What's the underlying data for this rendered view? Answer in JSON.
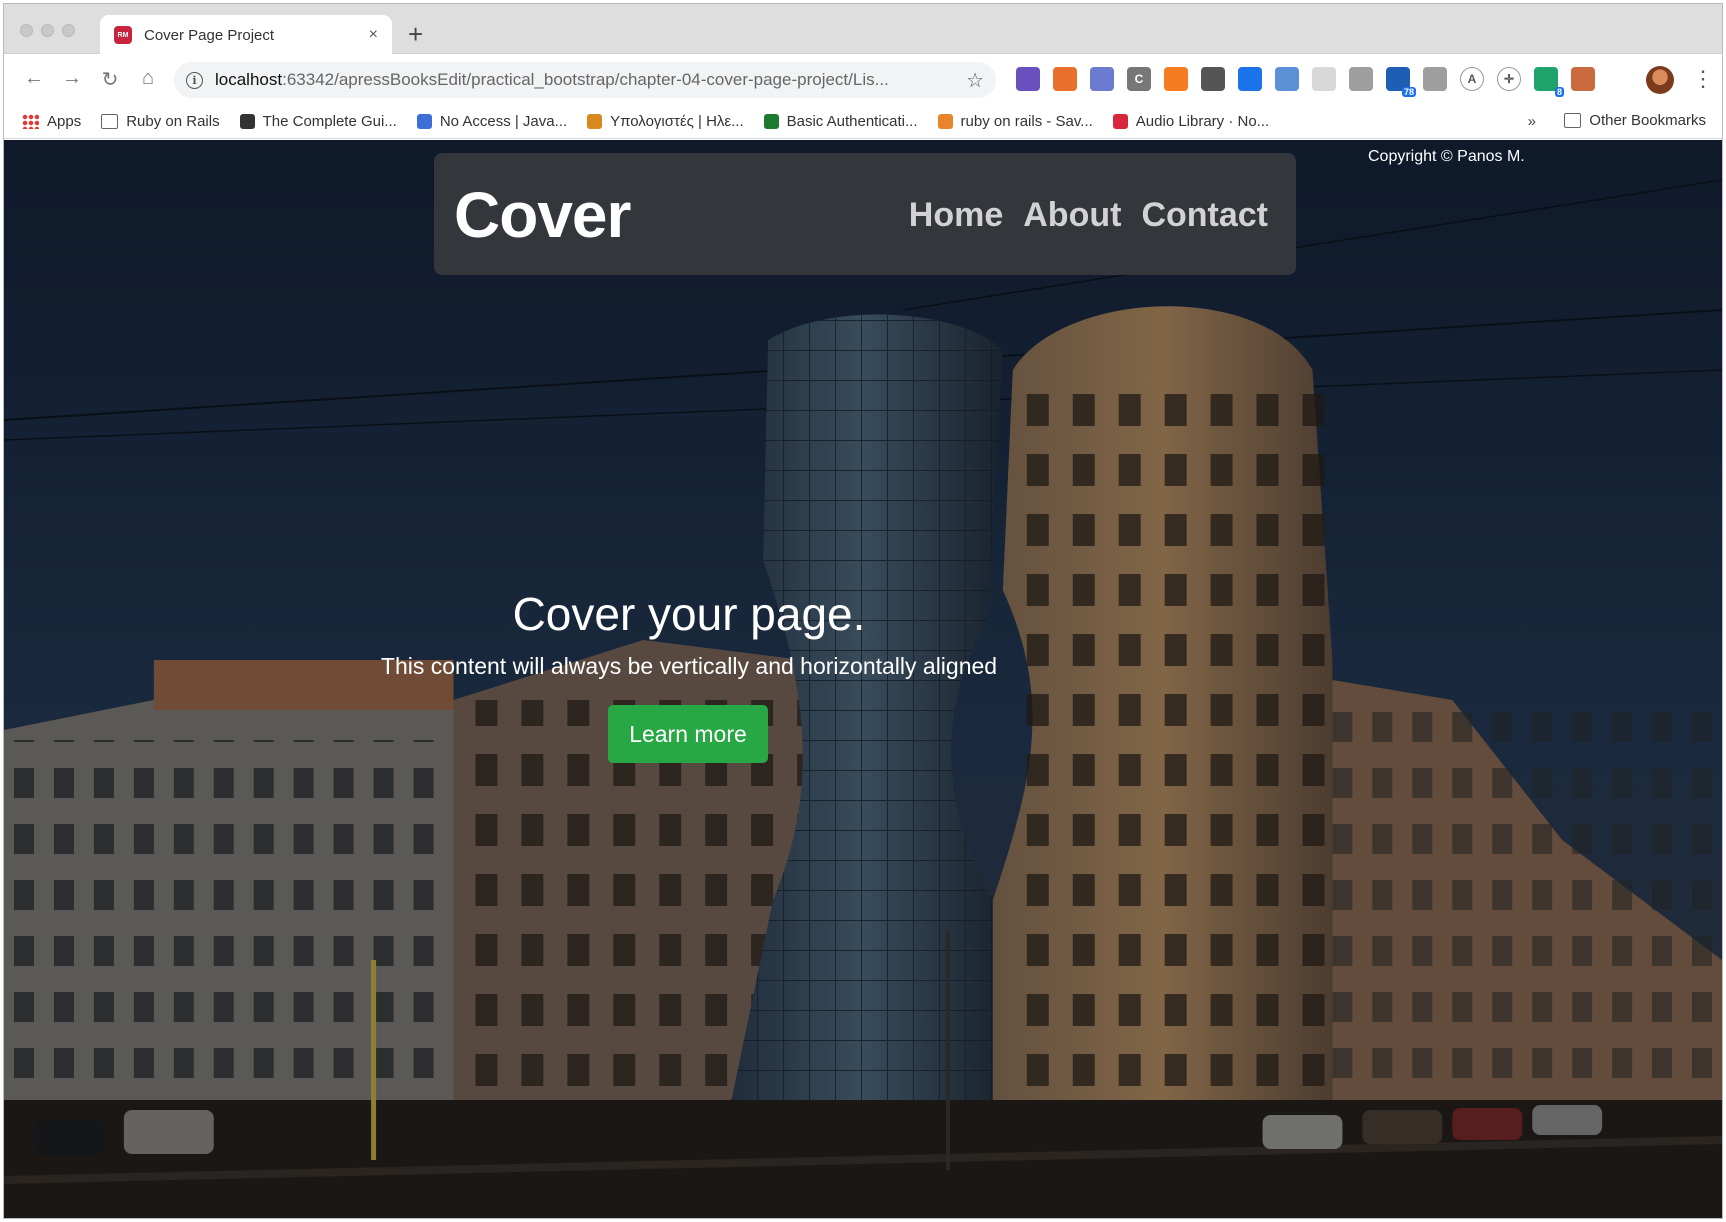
{
  "browser": {
    "tab": {
      "title": "Cover Page Project",
      "favicon_label": "RM",
      "close": "×"
    },
    "new_tab": "+",
    "nav": {
      "back": "←",
      "forward": "→",
      "reload": "↻",
      "home": "⌂"
    },
    "url": {
      "host": "localhost",
      "path": ":63342/apressBooksEdit/practical_bootstrap/chapter-04-cover-page-project/Lis..."
    },
    "star": "☆",
    "extensions": [
      {
        "icon": "eyedropper-icon",
        "color": "#6a4fbf",
        "label": ""
      },
      {
        "icon": "share-icon",
        "color": "#e8702a",
        "label": ""
      },
      {
        "icon": "disc-icon",
        "color": "#6b7bd0",
        "label": ""
      },
      {
        "icon": "c-icon",
        "color": "#777777",
        "label": "C"
      },
      {
        "icon": "gear-icon",
        "color": "#f47b20",
        "label": ""
      },
      {
        "icon": "bulb-icon",
        "color": "#555555",
        "label": ""
      },
      {
        "icon": "download-icon",
        "color": "#1a73e8",
        "label": ""
      },
      {
        "icon": "window-icon",
        "color": "#5b8fd6",
        "label": ""
      },
      {
        "icon": "grid-icon",
        "color": "#d8d8d8",
        "label": ""
      },
      {
        "icon": "chat-icon",
        "color": "#9e9e9e",
        "label": ""
      },
      {
        "icon": "folder-icon",
        "color": "#1e5fb5",
        "label": "",
        "badge": "78"
      },
      {
        "icon": "globe-icon",
        "color": "#9e9e9e",
        "label": ""
      },
      {
        "icon": "a-circle-icon",
        "color": "#ffffff",
        "label": "A"
      },
      {
        "icon": "move-icon",
        "color": "#ffffff",
        "label": "✛"
      },
      {
        "icon": "grammar-icon",
        "color": "#20a36b",
        "label": "",
        "badge": "8"
      },
      {
        "icon": "tabs-icon",
        "color": "#c96b3e",
        "label": ""
      }
    ],
    "menu": "⋮",
    "bookmarks": [
      {
        "label": "Apps",
        "icon": "apps-icon"
      },
      {
        "label": "Ruby on Rails",
        "icon": "folder-icon"
      },
      {
        "label": "The Complete Gui...",
        "icon": "ab-icon"
      },
      {
        "label": "No Access | Java...",
        "icon": "spark-icon"
      },
      {
        "label": "Υπολογιστές | Ηλε...",
        "icon": "balloon-icon"
      },
      {
        "label": "Basic Authenticati...",
        "icon": "cube-icon"
      },
      {
        "label": "ruby on rails - Sav...",
        "icon": "stack-icon"
      },
      {
        "label": "Audio Library · No...",
        "icon": "audio-icon"
      }
    ],
    "bookmarks_more": "»",
    "other_bookmarks": "Other Bookmarks"
  },
  "page": {
    "copyright": "Copyright © Panos M.",
    "brand": "Cover",
    "nav": [
      "Home",
      "About",
      "Contact"
    ],
    "hero": {
      "title": "Cover your page.",
      "lead": "This content will always be vertically and horizontally aligned",
      "button": "Learn more"
    },
    "colors": {
      "button": "#28a745",
      "navbar": "#33373c",
      "nav_link": "#d2d2d2"
    }
  }
}
